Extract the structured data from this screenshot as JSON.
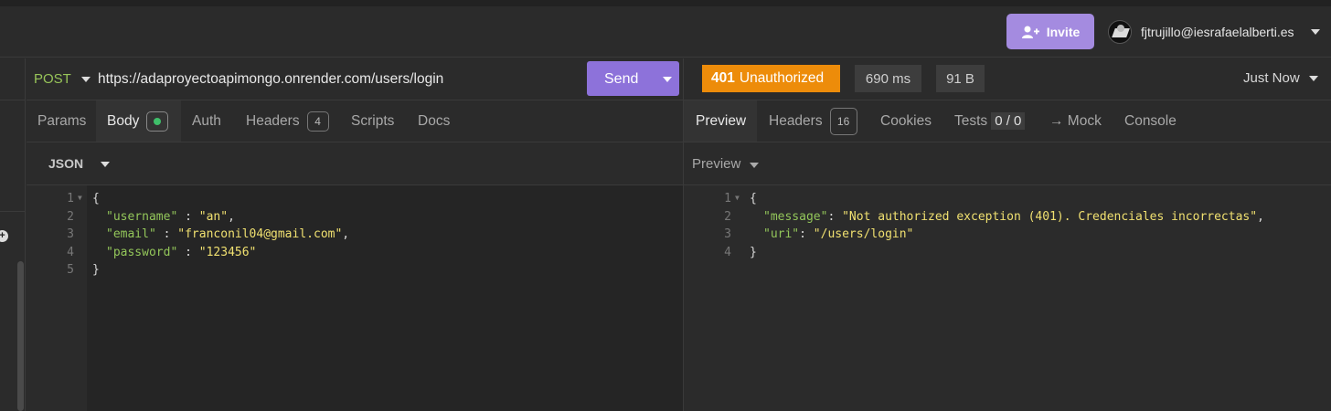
{
  "topbar": {
    "invite_label": "Invite",
    "user_email": "fjtrujillo@iesrafaelalberti.es"
  },
  "request": {
    "method": "POST",
    "url": "https://adaproyectoapimongo.onrender.com/users/login",
    "send_label": "Send",
    "tabs": {
      "params": "Params",
      "body": "Body",
      "auth": "Auth",
      "headers": "Headers",
      "headers_count": "4",
      "scripts": "Scripts",
      "docs": "Docs"
    },
    "body_type": "JSON",
    "body_lines": [
      {
        "n": "1",
        "text": "{"
      },
      {
        "n": "2",
        "key": "\"username\"",
        "sep": " : ",
        "val": "\"an\"",
        "end": ","
      },
      {
        "n": "3",
        "key": "\"email\"",
        "sep": " : ",
        "val": "\"franconil04@gmail.com\"",
        "end": ","
      },
      {
        "n": "4",
        "key": "\"password\"",
        "sep": " : ",
        "val": "\"123456\"",
        "end": ""
      },
      {
        "n": "5",
        "text": "}"
      }
    ]
  },
  "response": {
    "status_code": "401",
    "status_text": "Unauthorized",
    "time": "690 ms",
    "size": "91 B",
    "timestamp": "Just Now",
    "tabs": {
      "preview": "Preview",
      "headers": "Headers",
      "headers_count": "16",
      "cookies": "Cookies",
      "tests": "Tests",
      "tests_count": "0 / 0",
      "mock": "→ Mock",
      "console": "Console"
    },
    "preview_mode": "Preview",
    "body_lines": [
      {
        "n": "1",
        "text": "{"
      },
      {
        "n": "2",
        "key": "\"message\"",
        "sep": ": ",
        "val": "\"Not authorized exception (401). Credenciales incorrectas\"",
        "end": ","
      },
      {
        "n": "3",
        "key": "\"uri\"",
        "sep": ": ",
        "val": "\"/users/login\"",
        "end": ""
      },
      {
        "n": "4",
        "text": "}"
      }
    ]
  },
  "colors": {
    "accent": "#8d72da",
    "status_error": "#ed8c0a",
    "json_key": "#93c65a",
    "json_string": "#f0e070"
  }
}
